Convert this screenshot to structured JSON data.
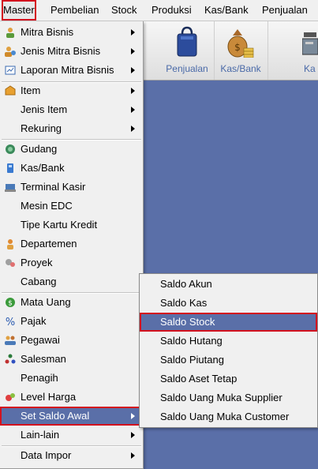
{
  "menubar": {
    "items": [
      "Master",
      "Pembelian",
      "Stock",
      "Produksi",
      "Kas/Bank",
      "Penjualan"
    ]
  },
  "toolbar": {
    "buttons": [
      {
        "label": "Penjualan",
        "icon": "shopping-bag-icon"
      },
      {
        "label": "Kas/Bank",
        "icon": "money-bag-icon"
      },
      {
        "label": "Ka",
        "icon": "cash-register-icon"
      }
    ]
  },
  "master_menu": {
    "items": [
      {
        "label": "Mitra Bisnis",
        "icon": "partner-icon",
        "submenu": true
      },
      {
        "label": "Jenis Mitra Bisnis",
        "icon": "partner-type-icon",
        "submenu": true
      },
      {
        "label": "Laporan Mitra Bisnis",
        "icon": "report-icon",
        "submenu": true
      },
      {
        "label": "Item",
        "icon": "item-icon",
        "submenu": true
      },
      {
        "label": "Jenis Item",
        "icon": "",
        "submenu": true
      },
      {
        "label": "Rekuring",
        "icon": "",
        "submenu": true
      },
      {
        "label": "Gudang",
        "icon": "warehouse-icon",
        "submenu": false
      },
      {
        "label": "Kas/Bank",
        "icon": "bank-icon",
        "submenu": false
      },
      {
        "label": "Terminal Kasir",
        "icon": "terminal-icon",
        "submenu": false
      },
      {
        "label": "Mesin EDC",
        "icon": "",
        "submenu": false
      },
      {
        "label": "Tipe Kartu Kredit",
        "icon": "",
        "submenu": false
      },
      {
        "label": "Departemen",
        "icon": "department-icon",
        "submenu": false
      },
      {
        "label": "Proyek",
        "icon": "project-icon",
        "submenu": false
      },
      {
        "label": "Cabang",
        "icon": "",
        "submenu": false
      },
      {
        "label": "Mata Uang",
        "icon": "currency-icon",
        "submenu": false
      },
      {
        "label": "Pajak",
        "icon": "percent-icon",
        "submenu": false
      },
      {
        "label": "Pegawai",
        "icon": "employee-icon",
        "submenu": false
      },
      {
        "label": "Salesman",
        "icon": "salesman-icon",
        "submenu": false
      },
      {
        "label": "Penagih",
        "icon": "",
        "submenu": false
      },
      {
        "label": "Level Harga",
        "icon": "price-level-icon",
        "submenu": false
      },
      {
        "label": "Set Saldo Awal",
        "icon": "",
        "submenu": true
      },
      {
        "label": "Lain-lain",
        "icon": "",
        "submenu": true
      },
      {
        "label": "Data Impor",
        "icon": "",
        "submenu": true
      }
    ]
  },
  "saldo_submenu": {
    "items": [
      "Saldo Akun",
      "Saldo Kas",
      "Saldo Stock",
      "Saldo Hutang",
      "Saldo Piutang",
      "Saldo Aset Tetap",
      "Saldo Uang Muka Supplier",
      "Saldo Uang Muka Customer"
    ]
  },
  "colors": {
    "highlight": "#5a6fa8",
    "callout": "#d3121e",
    "menu_bg": "#f0f0f0",
    "workspace": "#5a6fa8"
  }
}
